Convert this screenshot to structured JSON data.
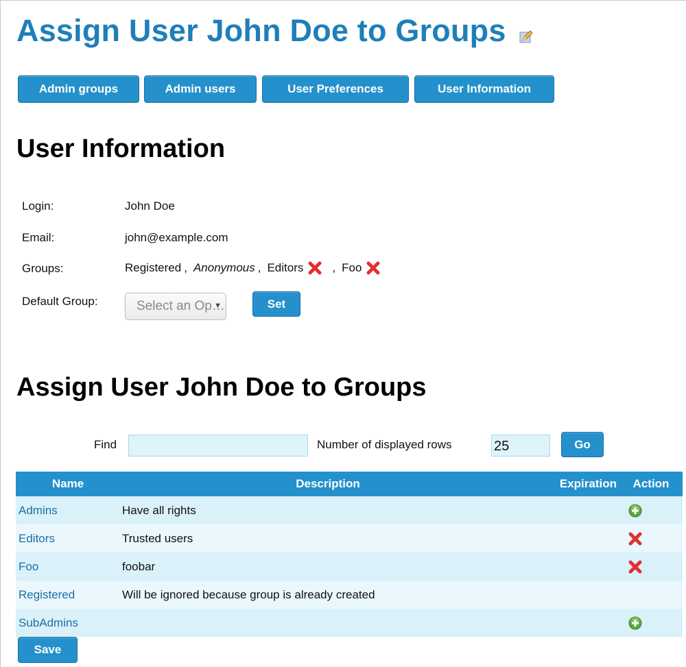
{
  "page": {
    "title": "Assign User John Doe to Groups",
    "edit_icon": "pencil-edit-icon"
  },
  "nav": {
    "buttons": [
      {
        "label": "Admin groups"
      },
      {
        "label": "Admin users"
      },
      {
        "label": "User Preferences"
      },
      {
        "label": "User Information"
      }
    ]
  },
  "user_info": {
    "heading": "User Information",
    "login_label": "Login:",
    "login_value": "John Doe",
    "email_label": "Email:",
    "email_value": "john@example.com",
    "groups_label": "Groups:",
    "groups": [
      {
        "name": "Registered",
        "removable": false,
        "italic": false
      },
      {
        "name": "Anonymous",
        "removable": false,
        "italic": true
      },
      {
        "name": "Editors",
        "removable": true,
        "italic": false
      },
      {
        "name": "Foo",
        "removable": true,
        "italic": false
      }
    ],
    "default_group_label": "Default Group:",
    "default_group_placeholder": "Select an Op…",
    "set_button": "Set"
  },
  "assign": {
    "heading": "Assign User John Doe to Groups",
    "find_label": "Find",
    "find_value": "",
    "rows_label": "Number of displayed rows",
    "rows_value": "25",
    "go_button": "Go",
    "save_button": "Save",
    "table": {
      "columns": [
        "Name",
        "Description",
        "Expiration",
        "Action"
      ],
      "rows": [
        {
          "name": "Admins",
          "description": "Have all rights",
          "expiration": "",
          "action": "add"
        },
        {
          "name": "Editors",
          "description": "Trusted users",
          "expiration": "",
          "action": "remove"
        },
        {
          "name": "Foo",
          "description": "foobar",
          "expiration": "",
          "action": "remove"
        },
        {
          "name": "Registered",
          "description": "Will be ignored because group is already created",
          "expiration": "",
          "action": ""
        },
        {
          "name": "SubAdmins",
          "description": "",
          "expiration": "",
          "action": "add"
        }
      ]
    }
  },
  "colors": {
    "accent": "#2491cc",
    "title": "#1f7fb8",
    "link": "#1a6fa3",
    "remove": "#e03030",
    "add": "#5aaa3a"
  }
}
